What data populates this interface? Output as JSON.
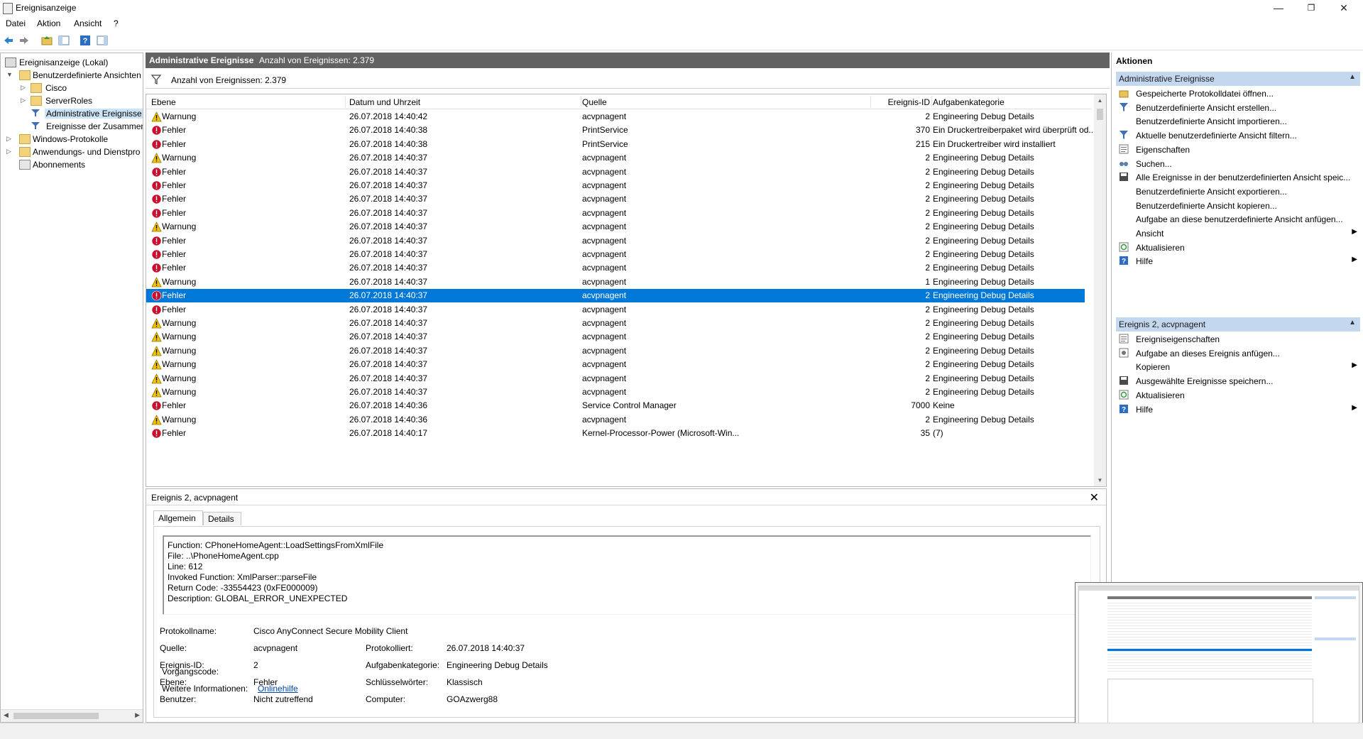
{
  "window": {
    "title": "Ereignisanzeige",
    "minimize": "—",
    "maximize": "❐",
    "close": "✕"
  },
  "menu": [
    "Datei",
    "Aktion",
    "Ansicht",
    "?"
  ],
  "tree": {
    "root": "Ereignisanzeige (Lokal)",
    "custom_views": "Benutzerdefinierte Ansichten",
    "cisco": "Cisco",
    "serverroles": "ServerRoles",
    "admin_events": "Administrative Ereignisse",
    "summary_events": "Ereignisse der Zusammen",
    "windows_logs": "Windows-Protokolle",
    "app_logs": "Anwendungs- und Dienstpro",
    "subscriptions": "Abonnements"
  },
  "center": {
    "title": "Administrative Ereignisse",
    "count_title": "Anzahl von Ereignissen: 2.379",
    "filter_text": "Anzahl von Ereignissen: 2.379"
  },
  "columns": [
    "Ebene",
    "Datum und Uhrzeit",
    "Quelle",
    "Ereignis-ID",
    "Aufgabenkategorie"
  ],
  "rows": [
    [
      "warn",
      "Warnung",
      "26.07.2018 14:40:42",
      "acvpnagent",
      "2",
      "Engineering Debug Details"
    ],
    [
      "err",
      "Fehler",
      "26.07.2018 14:40:38",
      "PrintService",
      "370",
      "Ein Druckertreiberpaket wird überprüft od..."
    ],
    [
      "err",
      "Fehler",
      "26.07.2018 14:40:38",
      "PrintService",
      "215",
      "Ein Druckertreiber wird installiert"
    ],
    [
      "warn",
      "Warnung",
      "26.07.2018 14:40:37",
      "acvpnagent",
      "2",
      "Engineering Debug Details"
    ],
    [
      "err",
      "Fehler",
      "26.07.2018 14:40:37",
      "acvpnagent",
      "2",
      "Engineering Debug Details"
    ],
    [
      "err",
      "Fehler",
      "26.07.2018 14:40:37",
      "acvpnagent",
      "2",
      "Engineering Debug Details"
    ],
    [
      "err",
      "Fehler",
      "26.07.2018 14:40:37",
      "acvpnagent",
      "2",
      "Engineering Debug Details"
    ],
    [
      "err",
      "Fehler",
      "26.07.2018 14:40:37",
      "acvpnagent",
      "2",
      "Engineering Debug Details"
    ],
    [
      "warn",
      "Warnung",
      "26.07.2018 14:40:37",
      "acvpnagent",
      "2",
      "Engineering Debug Details"
    ],
    [
      "err",
      "Fehler",
      "26.07.2018 14:40:37",
      "acvpnagent",
      "2",
      "Engineering Debug Details"
    ],
    [
      "err",
      "Fehler",
      "26.07.2018 14:40:37",
      "acvpnagent",
      "2",
      "Engineering Debug Details"
    ],
    [
      "err",
      "Fehler",
      "26.07.2018 14:40:37",
      "acvpnagent",
      "2",
      "Engineering Debug Details"
    ],
    [
      "warn",
      "Warnung",
      "26.07.2018 14:40:37",
      "acvpnagent",
      "1",
      "Engineering Debug Details"
    ],
    [
      "err",
      "Fehler",
      "26.07.2018 14:40:37",
      "acvpnagent",
      "2",
      "Engineering Debug Details"
    ],
    [
      "err",
      "Fehler",
      "26.07.2018 14:40:37",
      "acvpnagent",
      "2",
      "Engineering Debug Details"
    ],
    [
      "warn",
      "Warnung",
      "26.07.2018 14:40:37",
      "acvpnagent",
      "2",
      "Engineering Debug Details"
    ],
    [
      "warn",
      "Warnung",
      "26.07.2018 14:40:37",
      "acvpnagent",
      "2",
      "Engineering Debug Details"
    ],
    [
      "warn",
      "Warnung",
      "26.07.2018 14:40:37",
      "acvpnagent",
      "2",
      "Engineering Debug Details"
    ],
    [
      "warn",
      "Warnung",
      "26.07.2018 14:40:37",
      "acvpnagent",
      "2",
      "Engineering Debug Details"
    ],
    [
      "warn",
      "Warnung",
      "26.07.2018 14:40:37",
      "acvpnagent",
      "2",
      "Engineering Debug Details"
    ],
    [
      "warn",
      "Warnung",
      "26.07.2018 14:40:37",
      "acvpnagent",
      "2",
      "Engineering Debug Details"
    ],
    [
      "err",
      "Fehler",
      "26.07.2018 14:40:36",
      "Service Control Manager",
      "7000",
      "Keine"
    ],
    [
      "warn",
      "Warnung",
      "26.07.2018 14:40:36",
      "acvpnagent",
      "2",
      "Engineering Debug Details"
    ],
    [
      "err",
      "Fehler",
      "26.07.2018 14:40:17",
      "Kernel-Processor-Power (Microsoft-Win...",
      "35",
      "(7)"
    ]
  ],
  "selected_row": 13,
  "detail": {
    "header": "Ereignis 2, acvpnagent",
    "close": "✕",
    "tab_general": "Allgemein",
    "tab_details": "Details",
    "message_lines": [
      "Function: CPhoneHomeAgent::LoadSettingsFromXmlFile",
      "File: ..\\PhoneHomeAgent.cpp",
      "Line: 612",
      "Invoked Function: XmlParser::parseFile",
      "Return Code: -33554423 (0xFE000009)",
      "Description: GLOBAL_ERROR_UNEXPECTED"
    ],
    "labels": {
      "log_name": "Protokollname:",
      "source": "Quelle:",
      "event_id": "Ereignis-ID:",
      "level": "Ebene:",
      "user": "Benutzer:",
      "opcode": "Vorgangscode:",
      "more_info": "Weitere Informationen:",
      "logged": "Protokolliert:",
      "task_category": "Aufgabenkategorie:",
      "keywords": "Schlüsselwörter:",
      "computer": "Computer:"
    },
    "values": {
      "log_name": "Cisco AnyConnect Secure Mobility Client",
      "source": "acvpnagent",
      "event_id": "2",
      "level": "Fehler",
      "user": "Nicht zutreffend",
      "more_info": "Onlinehilfe",
      "logged": "26.07.2018 14:40:37",
      "task_category": "Engineering Debug Details",
      "keywords": "Klassisch",
      "computer": "GOAzwerg88"
    }
  },
  "actions": {
    "header": "Aktionen",
    "section1": "Administrative Ereignisse",
    "items1": [
      [
        "open-log-icon",
        "Gespeicherte Protokolldatei öffnen...",
        ""
      ],
      [
        "create-view-icon",
        "Benutzerdefinierte Ansicht erstellen...",
        ""
      ],
      [
        "",
        "Benutzerdefinierte Ansicht importieren...",
        ""
      ],
      [
        "filter-icon",
        "Aktuelle benutzerdefinierte Ansicht filtern...",
        ""
      ],
      [
        "properties-icon",
        "Eigenschaften",
        ""
      ],
      [
        "find-icon",
        "Suchen...",
        ""
      ],
      [
        "save-icon",
        "Alle Ereignisse in der benutzerdefinierten Ansicht speic...",
        ""
      ],
      [
        "",
        "Benutzerdefinierte Ansicht exportieren...",
        ""
      ],
      [
        "",
        "Benutzerdefinierte Ansicht kopieren...",
        ""
      ],
      [
        "",
        "Aufgabe an diese benutzerdefinierte Ansicht anfügen...",
        ""
      ],
      [
        "",
        "Ansicht",
        "▶"
      ],
      [
        "refresh-icon",
        "Aktualisieren",
        ""
      ],
      [
        "help-icon",
        "Hilfe",
        "▶"
      ]
    ],
    "section2": "Ereignis 2, acvpnagent",
    "items2": [
      [
        "properties-icon",
        "Ereigniseigenschaften",
        ""
      ],
      [
        "task-icon",
        "Aufgabe an dieses Ereignis anfügen...",
        ""
      ],
      [
        "",
        "Kopieren",
        "▶"
      ],
      [
        "save-icon",
        "Ausgewählte Ereignisse speichern...",
        ""
      ],
      [
        "refresh-icon",
        "Aktualisieren",
        ""
      ],
      [
        "help-icon",
        "Hilfe",
        "▶"
      ]
    ]
  },
  "colors": {
    "selection": "#0078d7",
    "title_bar_dark": "#626262",
    "section_bg": "#c3d7ee",
    "warning": "#f5c400",
    "error": "#c8102e"
  }
}
